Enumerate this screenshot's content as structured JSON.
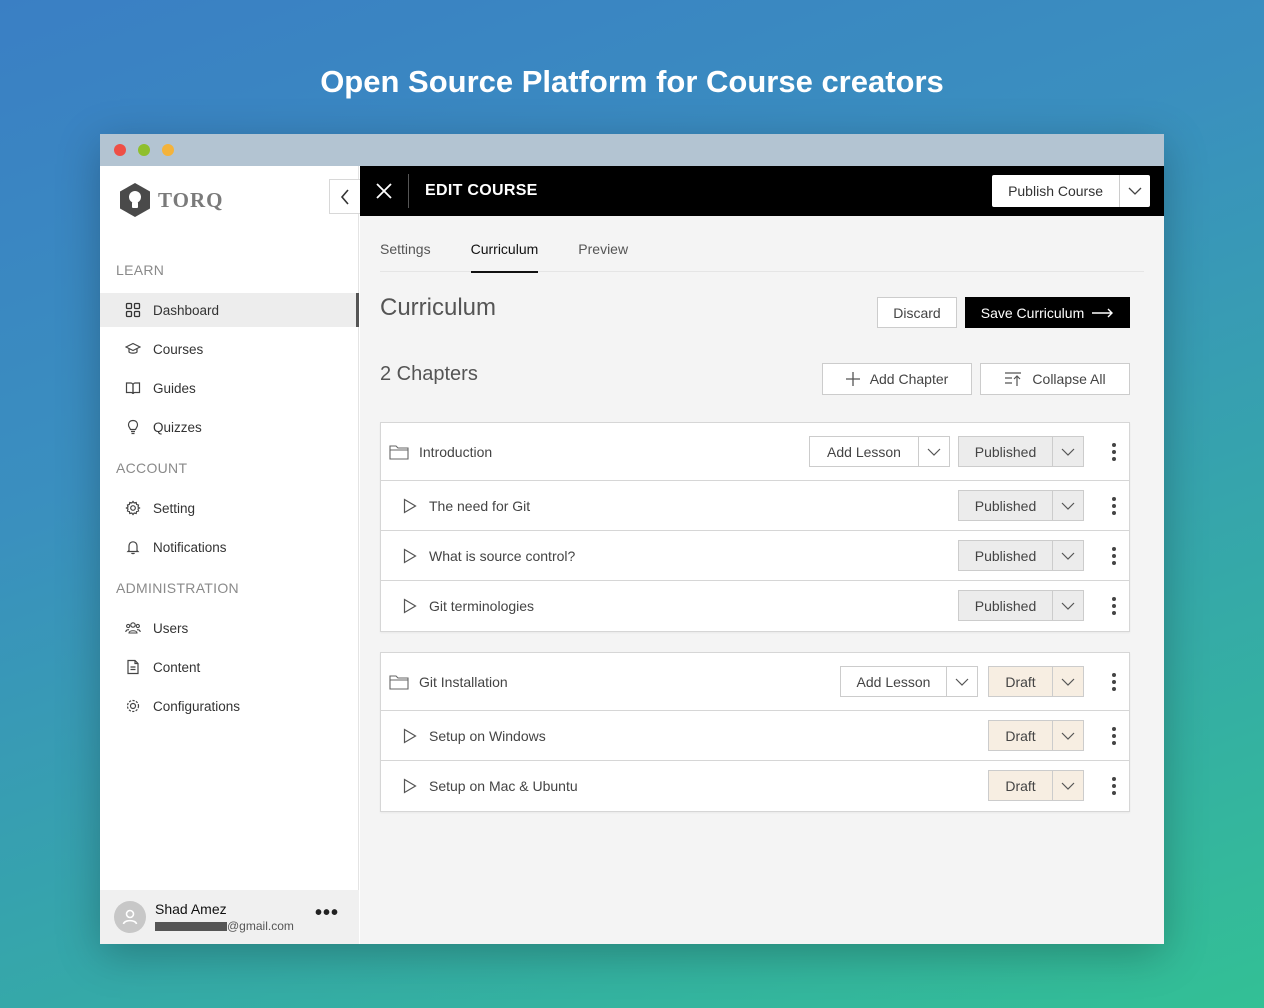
{
  "headline": "Open Source Platform for Course creators",
  "sidebar": {
    "logo_text": "TORQ",
    "sections": {
      "learn": "LEARN",
      "account": "ACCOUNT",
      "administration": "ADMINISTRATION"
    },
    "items": [
      {
        "label": "Dashboard",
        "icon": "grid-icon",
        "active": true
      },
      {
        "label": "Courses",
        "icon": "graduation-cap-icon"
      },
      {
        "label": "Guides",
        "icon": "book-icon"
      },
      {
        "label": "Quizzes",
        "icon": "lightbulb-icon"
      },
      {
        "label": "Setting",
        "icon": "gear-icon"
      },
      {
        "label": "Notifications",
        "icon": "bell-icon"
      },
      {
        "label": "Users",
        "icon": "users-icon"
      },
      {
        "label": "Content",
        "icon": "document-icon"
      },
      {
        "label": "Configurations",
        "icon": "cog-icon"
      }
    ],
    "user": {
      "name": "Shad Amez",
      "email_suffix": "@gmail.com"
    }
  },
  "topbar": {
    "title": "EDIT COURSE",
    "publish_label": "Publish Course"
  },
  "tabs": [
    "Settings",
    "Curriculum",
    "Preview"
  ],
  "active_tab": "Curriculum",
  "curriculum": {
    "heading": "Curriculum",
    "discard_label": "Discard",
    "save_label": "Save Curriculum",
    "chapters_heading": "2 Chapters",
    "add_chapter_label": "Add Chapter",
    "collapse_all_label": "Collapse All",
    "add_lesson_label": "Add Lesson",
    "chapters": [
      {
        "title": "Introduction",
        "status": "Published",
        "lessons": [
          {
            "title": "The need for Git",
            "status": "Published"
          },
          {
            "title": "What is source control?",
            "status": "Published"
          },
          {
            "title": "Git terminologies",
            "status": "Published"
          }
        ]
      },
      {
        "title": "Git Installation",
        "status": "Draft",
        "lessons": [
          {
            "title": "Setup on Windows",
            "status": "Draft"
          },
          {
            "title": "Setup on Mac & Ubuntu",
            "status": "Draft"
          }
        ]
      }
    ]
  },
  "colors": {
    "published_bg": "#ececec",
    "draft_bg": "#f7eee2",
    "topbar_bg": "#000000"
  }
}
